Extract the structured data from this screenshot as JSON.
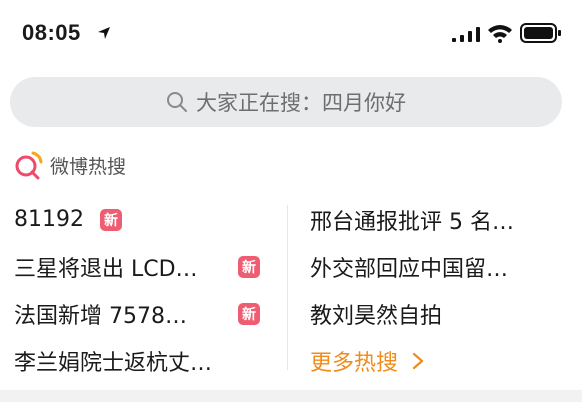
{
  "status_bar": {
    "time": "08:05"
  },
  "search": {
    "placeholder_text": "大家正在搜：四月你好"
  },
  "hot_section": {
    "title": "微博热搜",
    "left_items": [
      {
        "text": "81192",
        "badge": "新"
      },
      {
        "text": "三星将退出 LCD…",
        "badge": "新"
      },
      {
        "text": "法国新增 7578…",
        "badge": "新"
      },
      {
        "text": "李兰娟院士返杭丈…",
        "badge": ""
      }
    ],
    "right_items": [
      {
        "text": "邢台通报批评 5 名…"
      },
      {
        "text": "外交部回应中国留…"
      },
      {
        "text": "教刘昊然自拍"
      }
    ],
    "more_label": "更多热搜"
  },
  "colors": {
    "accent": "#f08c1b",
    "badge": "#ef5d73",
    "search_bg": "#e9eaec"
  }
}
